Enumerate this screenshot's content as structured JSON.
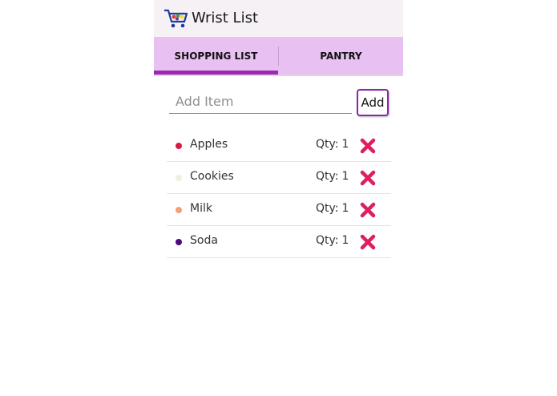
{
  "app": {
    "title": "Wrist List",
    "icon": "shopping-cart-icon"
  },
  "tabs": [
    {
      "label": "SHOPPING LIST",
      "selected": true
    },
    {
      "label": "PANTRY",
      "selected": false
    }
  ],
  "add_form": {
    "placeholder": "Add Item",
    "value": "",
    "button_label": "Add"
  },
  "items": [
    {
      "name": "Apples",
      "qty_label": "Qty:",
      "qty": "1",
      "color": "#d81b42"
    },
    {
      "name": "Cookies",
      "qty_label": "Qty:",
      "qty": "1",
      "color": "#f2f0dc"
    },
    {
      "name": "Milk",
      "qty_label": "Qty:",
      "qty": "1",
      "color": "#f5a075"
    },
    {
      "name": "Soda",
      "qty_label": "Qty:",
      "qty": "1",
      "color": "#4a0a80"
    }
  ],
  "colors": {
    "accent": "#9c27b0",
    "tab_bar": "#e8c1f2",
    "delete": "#e01e5a"
  },
  "icons": {
    "delete": "close-x-icon"
  }
}
